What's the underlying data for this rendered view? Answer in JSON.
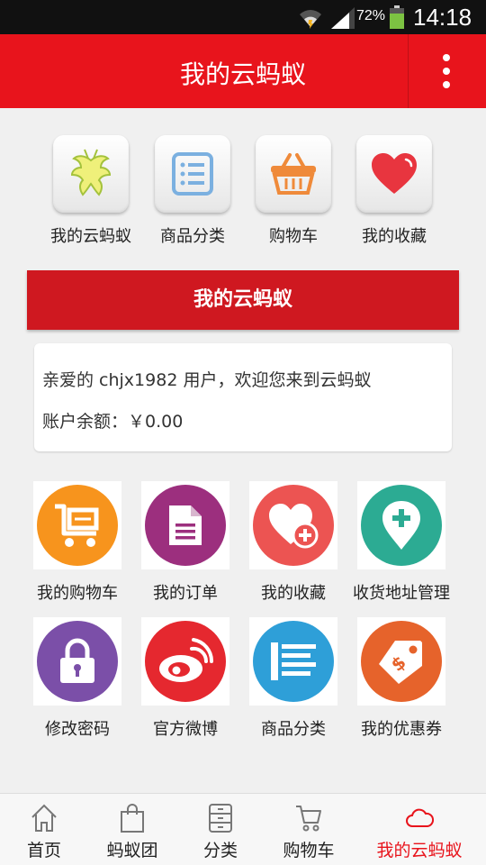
{
  "status_bar": {
    "battery_percent": "72%",
    "time": "14:18"
  },
  "header": {
    "title": "我的云蚂蚁",
    "menu_icon": "more-vertical-icon"
  },
  "quick_nav": [
    {
      "label": "我的云蚂蚁",
      "icon": "ant-icon"
    },
    {
      "label": "商品分类",
      "icon": "list-icon"
    },
    {
      "label": "购物车",
      "icon": "basket-icon"
    },
    {
      "label": "我的收藏",
      "icon": "heart-icon"
    }
  ],
  "banner": {
    "title": "我的云蚂蚁"
  },
  "welcome": {
    "greeting": "亲爱的 chjx1982 用户，欢迎您来到云蚂蚁",
    "balance": "账户余额：￥0.00"
  },
  "menu_grid": [
    {
      "label": "我的购物车",
      "icon": "cart-icon",
      "color": "#f7941d"
    },
    {
      "label": "我的订单",
      "icon": "document-icon",
      "color": "#9c2f7e"
    },
    {
      "label": "我的收藏",
      "icon": "heart-plus-icon",
      "color": "#ec5452"
    },
    {
      "label": "收货地址管理",
      "icon": "location-plus-icon",
      "color": "#2cab93"
    },
    {
      "label": "修改密码",
      "icon": "lock-icon",
      "color": "#7b4fa8"
    },
    {
      "label": "官方微博",
      "icon": "weibo-icon",
      "color": "#e5282f"
    },
    {
      "label": "商品分类",
      "icon": "list-icon",
      "color": "#2e9fd8"
    },
    {
      "label": "我的优惠券",
      "icon": "price-tag-icon",
      "color": "#e6632b"
    }
  ],
  "bottom_nav": [
    {
      "label": "首页",
      "icon": "home-icon",
      "active": false
    },
    {
      "label": "蚂蚁团",
      "icon": "bag-icon",
      "active": false
    },
    {
      "label": "分类",
      "icon": "cabinet-icon",
      "active": false
    },
    {
      "label": "购物车",
      "icon": "cart-icon",
      "active": false
    },
    {
      "label": "我的云蚂蚁",
      "icon": "cloud-icon",
      "active": true
    }
  ],
  "colors": {
    "brand_red": "#e8141c",
    "banner_red": "#cf1820",
    "background": "#f0f0f0"
  }
}
